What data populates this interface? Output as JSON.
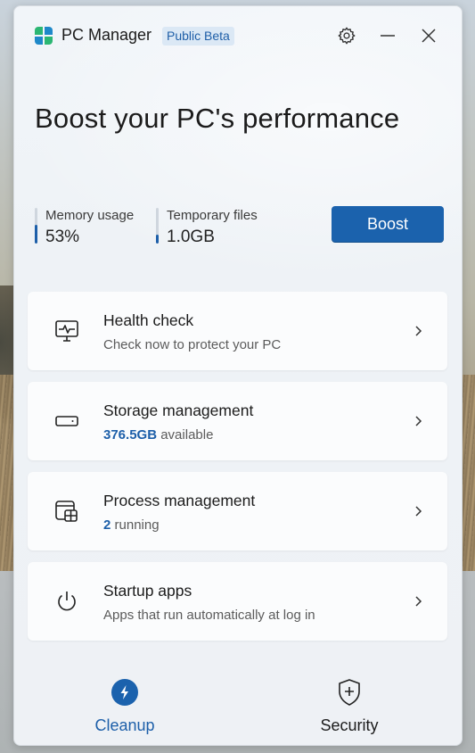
{
  "app": {
    "title": "PC Manager",
    "badge": "Public Beta"
  },
  "headline": "Boost your PC's performance",
  "stats": {
    "memory": {
      "label": "Memory usage",
      "value": "53%",
      "fill_percent": 53
    },
    "temp": {
      "label": "Temporary files",
      "value": "1.0GB",
      "fill_percent": 25
    }
  },
  "boost_label": "Boost",
  "cards": [
    {
      "title": "Health check",
      "sub": "Check now to protect your PC",
      "highlight": "",
      "icon": "health-monitor-icon"
    },
    {
      "title": "Storage management",
      "sub": " available",
      "highlight": "376.5GB",
      "icon": "storage-drive-icon"
    },
    {
      "title": "Process management",
      "sub": " running",
      "highlight": "2",
      "icon": "process-window-icon"
    },
    {
      "title": "Startup apps",
      "sub": "Apps that run automatically at log in",
      "highlight": "",
      "icon": "power-icon"
    }
  ],
  "nav": {
    "cleanup": "Cleanup",
    "security": "Security"
  },
  "colors": {
    "accent": "#1b62ad",
    "accent_text": "#1d5fa9"
  }
}
